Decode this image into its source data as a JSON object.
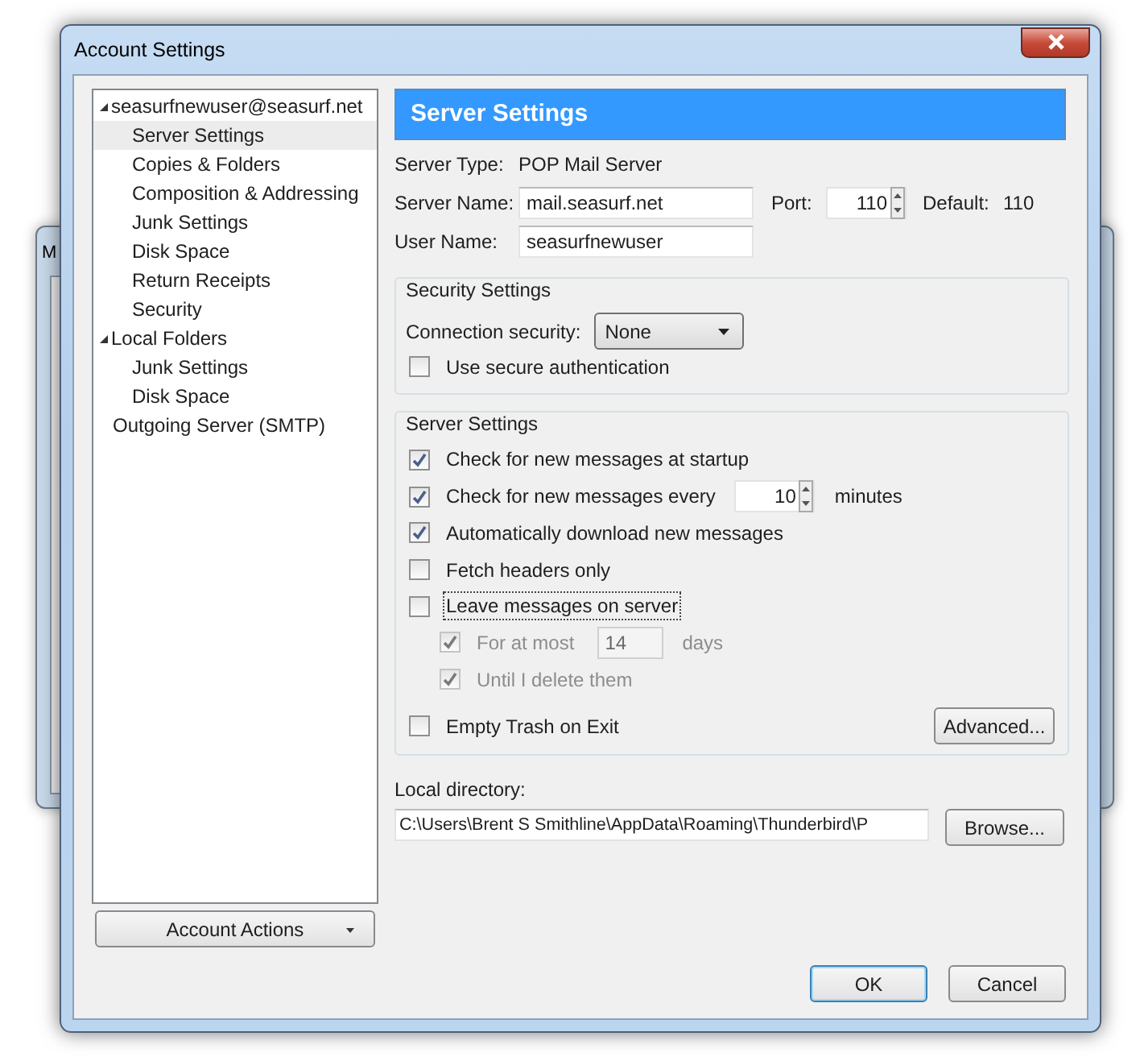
{
  "background_window": {
    "title": "M"
  },
  "window": {
    "title": "Account Settings"
  },
  "tree": [
    {
      "label": "seasurfnewuser@seasurf.net",
      "expanded": true,
      "selected": false,
      "children": [
        {
          "label": "Server Settings",
          "selected": true
        },
        {
          "label": "Copies & Folders",
          "selected": false
        },
        {
          "label": "Composition & Addressing",
          "selected": false
        },
        {
          "label": "Junk Settings",
          "selected": false
        },
        {
          "label": "Disk Space",
          "selected": false
        },
        {
          "label": "Return Receipts",
          "selected": false
        },
        {
          "label": "Security",
          "selected": false
        }
      ]
    },
    {
      "label": "Local Folders",
      "expanded": true,
      "selected": false,
      "children": [
        {
          "label": "Junk Settings",
          "selected": false
        },
        {
          "label": "Disk Space",
          "selected": false
        }
      ]
    },
    {
      "label": "Outgoing Server (SMTP)",
      "selected": false
    }
  ],
  "account_actions": {
    "label": "Account Actions"
  },
  "header": "Server Settings",
  "server_type": {
    "label": "Server Type:",
    "value": "POP Mail Server"
  },
  "server_name": {
    "label": "Server Name:",
    "value": "mail.seasurf.net"
  },
  "port": {
    "label": "Port:",
    "value": "110"
  },
  "default_port": {
    "label": "Default:",
    "value": "110"
  },
  "user_name": {
    "label": "User Name:",
    "value": "seasurfnewuser"
  },
  "security_settings": {
    "title": "Security Settings",
    "connection_label": "Connection security:",
    "connection_value": "None",
    "secure_auth": {
      "label": "Use secure authentication",
      "checked": false
    }
  },
  "server_settings": {
    "title": "Server Settings",
    "items": [
      {
        "label": "Check for new messages at startup",
        "checked": true,
        "disabled": false,
        "focused": false
      },
      {
        "label": "Check for new messages every",
        "checked": true,
        "disabled": false,
        "focused": false,
        "field": {
          "value": "10",
          "spin": true,
          "suffix": "minutes"
        }
      },
      {
        "label": "Automatically download new messages",
        "checked": true,
        "disabled": false,
        "focused": false
      },
      {
        "label": "Fetch headers only",
        "checked": false,
        "disabled": false,
        "focused": false
      },
      {
        "label": "Leave messages on server",
        "checked": false,
        "disabled": false,
        "focused": true,
        "children": [
          {
            "label": "For at most",
            "checked": true,
            "disabled": true,
            "focused": false,
            "field": {
              "value": "14",
              "spin": false,
              "suffix": "days"
            }
          },
          {
            "label": "Until I delete them",
            "checked": true,
            "disabled": true,
            "focused": false
          }
        ]
      }
    ],
    "empty_trash": {
      "label": "Empty Trash on Exit",
      "checked": false
    },
    "advanced_button": "Advanced..."
  },
  "local_directory": {
    "label": "Local directory:",
    "value": "C:\\Users\\Brent S Smithline\\AppData\\Roaming\\Thunderbird\\P",
    "browse": "Browse..."
  },
  "buttons": [
    "OK",
    "Cancel"
  ]
}
